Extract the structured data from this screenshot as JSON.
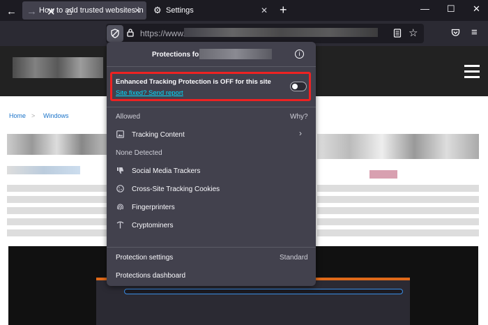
{
  "tabs": [
    {
      "label": "How to add trusted websites in",
      "close": "✕"
    },
    {
      "label": "Settings",
      "close": "✕"
    }
  ],
  "new_tab": "+",
  "window_controls": {
    "minimize": "—",
    "maximize": "☐",
    "close": "✕"
  },
  "nav": {
    "back": "←",
    "forward": "→",
    "stop": "✕",
    "home": "⌂"
  },
  "url": {
    "text": "https://www."
  },
  "page": {
    "breadcrumb": [
      "Home",
      "Windows"
    ],
    "breadcrumb_sep": ">"
  },
  "panel": {
    "title": "Protections for",
    "info": "i",
    "etp_text": "Enhanced Tracking Protection is OFF for this site",
    "etp_link": "Site fixed? Send report",
    "allowed_label": "Allowed",
    "why_label": "Why?",
    "allowed_items": [
      {
        "label": "Tracking Content",
        "icon": "image-icon"
      }
    ],
    "none_label": "None Detected",
    "none_items": [
      {
        "label": "Social Media Trackers",
        "icon": "thumbs-down-icon"
      },
      {
        "label": "Cross-Site Tracking Cookies",
        "icon": "cookie-icon"
      },
      {
        "label": "Fingerprinters",
        "icon": "fingerprint-icon"
      },
      {
        "label": "Cryptominers",
        "icon": "pickaxe-icon"
      }
    ],
    "protection_settings": "Protection settings",
    "protection_level": "Standard",
    "dashboard": "Protections dashboard"
  },
  "colors": {
    "accent_link": "#00ddff",
    "highlight_border": "#ee2222",
    "panel_bg": "#42414d"
  }
}
